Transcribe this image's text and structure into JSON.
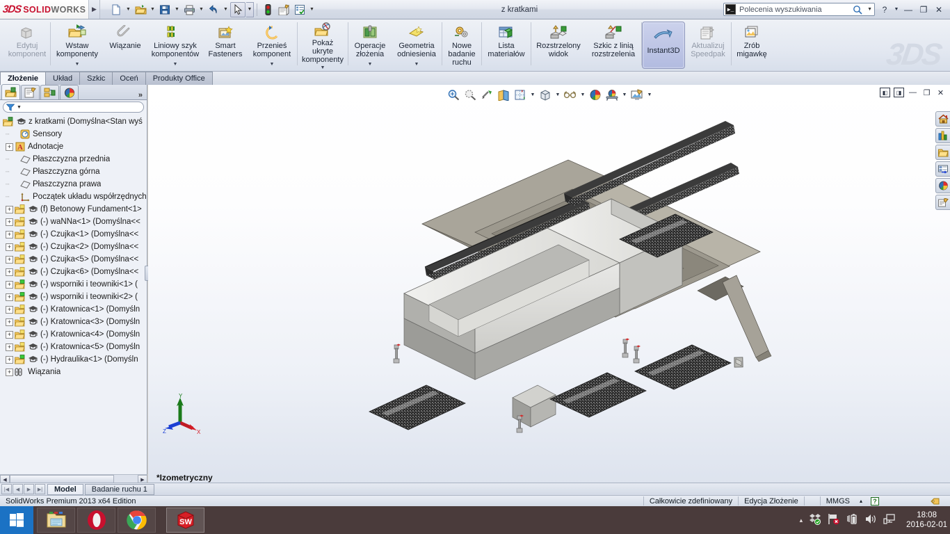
{
  "titlebar": {
    "brand_3ds": "3DS",
    "brand_name": "SOLID",
    "brand_name2": "WORKS",
    "document_title": "z kratkami",
    "search": {
      "placeholder": "Polecenia wyszukiwania",
      "icon": "console-icon"
    },
    "quick_access": [
      {
        "name": "new-document",
        "icon": "new-doc-icon",
        "caret": true
      },
      {
        "name": "open-document",
        "icon": "open-folder-icon",
        "caret": true
      },
      {
        "name": "save-document",
        "icon": "save-disk-icon",
        "caret": true
      },
      {
        "name": "print-document",
        "icon": "printer-icon",
        "caret": true
      },
      {
        "name": "undo",
        "icon": "undo-arrow-icon",
        "caret": true
      },
      {
        "name": "select",
        "icon": "cursor-arrow-icon",
        "caret": true,
        "selected": true
      },
      {
        "name": "rebuild",
        "icon": "traffic-light-icon",
        "caret": false
      },
      {
        "name": "options",
        "icon": "options-gear-icon",
        "caret": false
      },
      {
        "name": "properties",
        "icon": "checklist-icon",
        "caret": true
      }
    ],
    "window_controls": {
      "help": "?",
      "minimize": "—",
      "restore": "❐",
      "close": "✕"
    }
  },
  "ribbon": {
    "watermark": "3DS",
    "buttons": [
      {
        "label": "Edytuj\nkomponent",
        "icon": "edit-component-icon",
        "disabled": true,
        "caret": false,
        "active": false
      },
      {
        "label": "Wstaw\nkomponenty",
        "icon": "insert-components-icon",
        "disabled": false,
        "caret": true,
        "active": false
      },
      {
        "label": "Wiązanie",
        "icon": "mate-paperclip-icon",
        "disabled": false,
        "caret": false,
        "active": false
      },
      {
        "label": "Liniowy szyk\nkomponentów",
        "icon": "linear-pattern-icon",
        "disabled": false,
        "caret": true,
        "active": false
      },
      {
        "label": "Smart\nFasteners",
        "icon": "smart-fasteners-icon",
        "disabled": false,
        "caret": false,
        "active": false
      },
      {
        "label": "Przenieś\nkomponent",
        "icon": "move-component-icon",
        "disabled": false,
        "caret": true,
        "active": false
      },
      {
        "label": "Pokaż\nukryte\nkomponenty",
        "icon": "show-hidden-components-icon",
        "disabled": false,
        "caret": true,
        "active": false
      },
      {
        "label": "Operacje\nzłożenia",
        "icon": "assembly-features-icon",
        "disabled": false,
        "caret": true,
        "active": false
      },
      {
        "label": "Geometria\nodniesienia",
        "icon": "reference-geometry-icon",
        "disabled": false,
        "caret": true,
        "active": false
      },
      {
        "label": "Nowe\nbadanie\nruchu",
        "icon": "new-motion-study-icon",
        "disabled": false,
        "caret": false,
        "active": false
      },
      {
        "label": "Lista\nmateriałów",
        "icon": "bill-of-materials-icon",
        "disabled": false,
        "caret": false,
        "active": false
      },
      {
        "label": "Rozstrzelony\nwidok",
        "icon": "exploded-view-icon",
        "disabled": false,
        "caret": false,
        "active": false
      },
      {
        "label": "Szkic z linią\nrozstrzelenia",
        "icon": "explode-line-sketch-icon",
        "disabled": false,
        "caret": false,
        "active": false
      },
      {
        "label": "Instant3D",
        "icon": "instant3d-icon",
        "disabled": false,
        "caret": false,
        "active": true
      },
      {
        "label": "Aktualizuj\nSpeedpak",
        "icon": "update-speedpak-icon",
        "disabled": true,
        "caret": false,
        "active": false
      },
      {
        "label": "Zrób\nmigawkę",
        "icon": "take-snapshot-icon",
        "disabled": false,
        "caret": false,
        "active": false
      }
    ]
  },
  "command_tabs": [
    {
      "label": "Złożenie",
      "selected": true
    },
    {
      "label": "Układ",
      "selected": false
    },
    {
      "label": "Szkic",
      "selected": false
    },
    {
      "label": "Oceń",
      "selected": false
    },
    {
      "label": "Produkty Office",
      "selected": false
    }
  ],
  "left_panel": {
    "tabs": [
      {
        "name": "feature-manager-tab",
        "icon": "feature-tree-icon",
        "selected": true
      },
      {
        "name": "property-manager-tab",
        "icon": "property-manager-icon",
        "selected": false
      },
      {
        "name": "configuration-manager-tab",
        "icon": "configuration-manager-icon",
        "selected": false
      },
      {
        "name": "display-manager-tab",
        "icon": "display-manager-icon",
        "selected": false
      }
    ],
    "more_label": "»",
    "filter_placeholder": "",
    "tree": [
      {
        "label": "z kratkami  (Domyślna<Stan wyś",
        "icon": "assembly-icon",
        "expander": "none",
        "indent": 0,
        "root": true
      },
      {
        "label": "Sensory",
        "icon": "sensors-icon",
        "expander": "none",
        "indent": 1
      },
      {
        "label": "Adnotacje",
        "icon": "annotations-icon",
        "expander": "plus",
        "indent": 1
      },
      {
        "label": "Płaszczyzna przednia",
        "icon": "plane-icon",
        "expander": "none",
        "indent": 1
      },
      {
        "label": "Płaszczyzna górna",
        "icon": "plane-icon",
        "expander": "none",
        "indent": 1
      },
      {
        "label": "Płaszczyzna prawa",
        "icon": "plane-icon",
        "expander": "none",
        "indent": 1
      },
      {
        "label": "Początek układu współrzędnych",
        "icon": "origin-icon",
        "expander": "none",
        "indent": 1
      },
      {
        "label": "(f) Betonowy Fundament<1>",
        "icon": "part-icon",
        "expander": "plus",
        "indent": 1
      },
      {
        "label": "(-) waNNa<1> (Domyślna<<",
        "icon": "part-icon",
        "expander": "plus",
        "indent": 1
      },
      {
        "label": "(-) Czujka<1> (Domyślna<<",
        "icon": "part-icon",
        "expander": "plus",
        "indent": 1
      },
      {
        "label": "(-) Czujka<2> (Domyślna<<",
        "icon": "part-icon",
        "expander": "plus",
        "indent": 1
      },
      {
        "label": "(-) Czujka<5> (Domyślna<<",
        "icon": "part-icon",
        "expander": "plus",
        "indent": 1
      },
      {
        "label": "(-) Czujka<6> (Domyślna<<",
        "icon": "part-icon",
        "expander": "plus",
        "indent": 1
      },
      {
        "label": "(-) wsporniki i teowniki<1> (",
        "icon": "subassembly-icon",
        "expander": "plus",
        "indent": 1
      },
      {
        "label": "(-) wsporniki i teowniki<2> (",
        "icon": "subassembly-icon",
        "expander": "plus",
        "indent": 1
      },
      {
        "label": "(-) Kratownica<1> (Domyśln",
        "icon": "part-icon",
        "expander": "plus",
        "indent": 1
      },
      {
        "label": "(-) Kratownica<3> (Domyśln",
        "icon": "part-icon",
        "expander": "plus",
        "indent": 1
      },
      {
        "label": "(-) Kratownica<4> (Domyśln",
        "icon": "part-icon",
        "expander": "plus",
        "indent": 1
      },
      {
        "label": "(-) Kratownica<5> (Domyśln",
        "icon": "part-icon",
        "expander": "plus",
        "indent": 1
      },
      {
        "label": "(-) Hydraulika<1> (Domyśln",
        "icon": "subassembly-icon",
        "expander": "plus",
        "indent": 1
      },
      {
        "label": "Wiązania",
        "icon": "mates-folder-icon",
        "expander": "plus",
        "indent": 1
      }
    ]
  },
  "viewport": {
    "toolbar": [
      {
        "name": "zoom-to-fit-button",
        "icon": "zoom-fit-icon",
        "caret": false
      },
      {
        "name": "zoom-to-area-button",
        "icon": "zoom-area-icon",
        "caret": false
      },
      {
        "name": "previous-view-button",
        "icon": "previous-view-icon",
        "caret": false
      },
      {
        "name": "section-view-button",
        "icon": "section-view-icon",
        "caret": false
      },
      {
        "name": "view-orientation-button",
        "icon": "view-orientation-icon",
        "caret": true
      },
      {
        "name": "display-style-button",
        "icon": "display-style-cube-icon",
        "caret": true
      },
      {
        "name": "hide-show-items-button",
        "icon": "glasses-icon",
        "caret": true
      },
      {
        "name": "apply-scene-button",
        "icon": "scene-sphere-icon",
        "caret": false
      },
      {
        "name": "view-settings-button",
        "icon": "view-settings-icon",
        "caret": true
      },
      {
        "name": "section-properties-button",
        "icon": "render-preview-icon",
        "caret": true
      }
    ],
    "window_controls": {
      "restore_left": "◧",
      "restore_right": "◨",
      "minimize": "—",
      "restore": "❐",
      "close": "✕"
    },
    "view_label": "*Izometryczny",
    "triad": {
      "x_label": "X",
      "y_label": "Y",
      "z_label": "Z",
      "x_color": "#e01b24",
      "y_color": "#1a7a1a",
      "z_color": "#1b3fd4"
    }
  },
  "task_pane": [
    {
      "name": "sw-resources-button",
      "icon": "home-icon"
    },
    {
      "name": "design-library-button",
      "icon": "design-library-icon"
    },
    {
      "name": "file-explorer-button",
      "icon": "folder-icon"
    },
    {
      "name": "view-palette-button",
      "icon": "view-palette-icon"
    },
    {
      "name": "appearances-scenes-button",
      "icon": "appearances-sphere-icon"
    },
    {
      "name": "custom-properties-button",
      "icon": "custom-properties-icon"
    }
  ],
  "bottom_tabs": {
    "nav": [
      "⏮",
      "◀",
      "▶",
      "⏭"
    ],
    "tabs": [
      {
        "label": "Model",
        "selected": true
      },
      {
        "label": "Badanie ruchu 1",
        "selected": false
      }
    ]
  },
  "status_bar": {
    "edition": "SolidWorks Premium 2013 x64 Edition",
    "state": "Całkowicie zdefiniowany",
    "edit_mode": "Edycja Złożenie",
    "units": "MMGS",
    "units_caret": "▴",
    "help_badge": "?",
    "tag_icon": "tag-icon"
  },
  "taskbar": {
    "start": {
      "name": "start-button",
      "icon": "windows-logo-icon"
    },
    "items": [
      {
        "name": "file-explorer-task",
        "icon": "file-explorer-icon",
        "active": false
      },
      {
        "name": "opera-task",
        "icon": "opera-icon",
        "active": false
      },
      {
        "name": "chrome-task",
        "icon": "chrome-icon",
        "active": false
      },
      {
        "name": "solidworks-task",
        "icon": "solidworks-cube-icon",
        "active": true
      }
    ],
    "tray": {
      "overflow": "▴",
      "icons": [
        "dropbox-icon",
        "network-flag-icon",
        "battery-icon",
        "volume-icon",
        "display-icon"
      ],
      "time": "18:08",
      "date": "2016-02-01"
    }
  },
  "colors": {
    "accent_red": "#c8102e",
    "ribbon_bg": "#e3e8f1",
    "active_btn": "#b2bbe0",
    "taskbar_bg": "#4a3b3b",
    "start_blue": "#1b72c4"
  }
}
